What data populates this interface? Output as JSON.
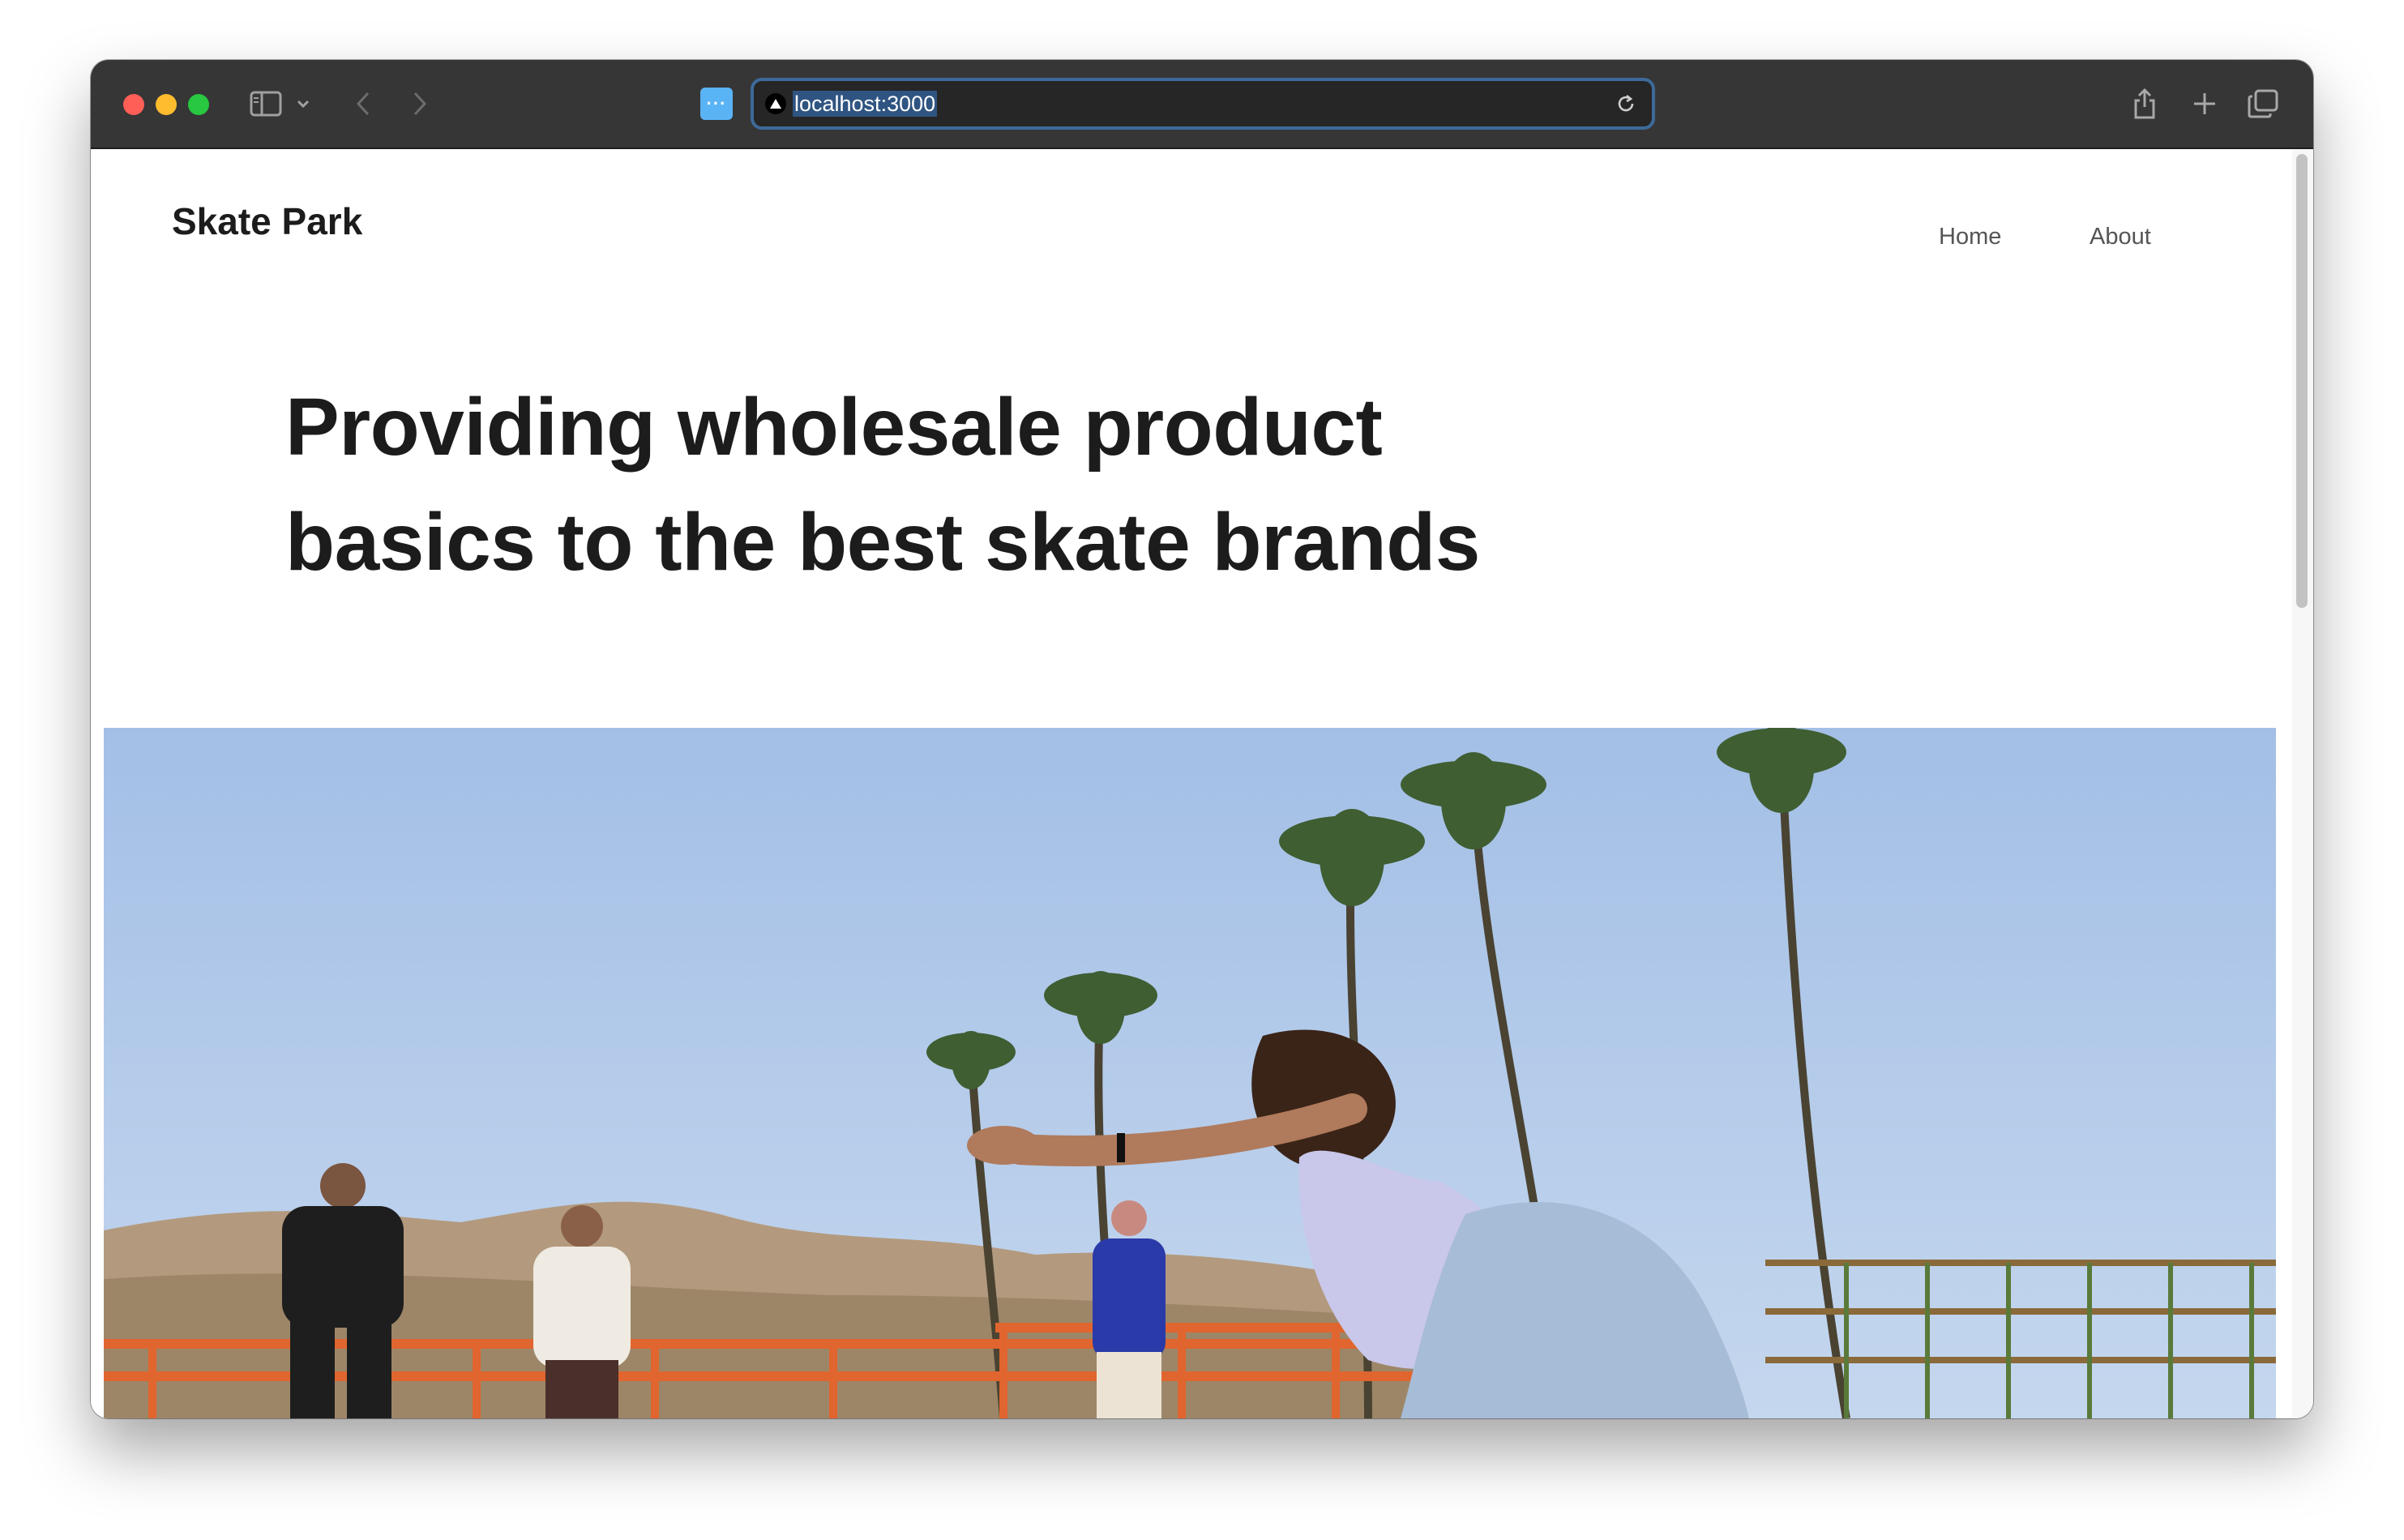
{
  "browser": {
    "url": "localhost:3000"
  },
  "site": {
    "brand": "Skate Park",
    "nav": [
      "Home",
      "About"
    ]
  },
  "hero": {
    "headline_line1": "Providing wholesale product",
    "headline_line2": "basics to the best skate brands",
    "image_description": "skateboarder-with-palm-trees"
  },
  "colors": {
    "toolbar": "#363636",
    "address_focus": "#3d6a9a",
    "text_dark": "#1c1c1c",
    "sky": "#a9c6ea"
  },
  "icons": [
    "sidebar-icon",
    "chevron-down-icon",
    "chevron-left-icon",
    "chevron-right-icon",
    "reload-icon",
    "share-icon",
    "plus-icon",
    "tabs-overview-icon"
  ]
}
